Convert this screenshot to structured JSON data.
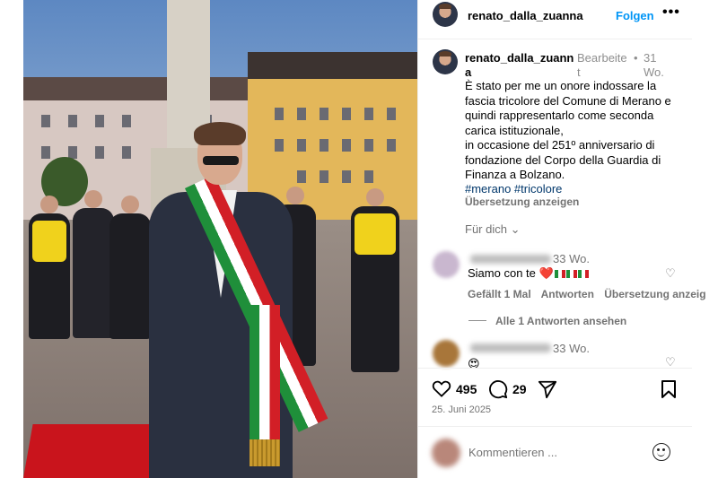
{
  "post": {
    "username": "renato_dalla_zuanna",
    "follow_label": "Folgen",
    "more_label": "•••",
    "photo_alt": "Mann mit Tricolore-Schärpe vor Ehrengarde auf einem Platz"
  },
  "caption": {
    "username_line": "renato_dalla_zuann a",
    "edited": "Bearbeite t",
    "dot": "•",
    "age": "31 Wo.",
    "lines": [
      "È stato per me un onore indossare la fascia tricolore del Comune di Merano e quindi rappresentarlo come seconda carica istituzionale,",
      "in occasione del 251º anniversario di fondazione del Corpo della Guardia di Finanza a Bolzano."
    ],
    "hashtags": "#merano #tricolore",
    "translate_label": "Übersetzung anzeigen",
    "for_you_label": "Für dich ⌄"
  },
  "comments": [
    {
      "age": "33 Wo.",
      "text": "Siamo con te",
      "emoji": "❤️",
      "likes_label": "Gefällt 1 Mal",
      "reply_label": "Antworten",
      "translate_label": "Übersetzung anzeig",
      "view_replies": "Alle 1 Antworten ansehen"
    },
    {
      "age": "33 Wo.",
      "text": "😍"
    }
  ],
  "actions": {
    "like_icon": "heart-icon",
    "like_count": "495",
    "comment_icon": "comment-icon",
    "comment_count": "29",
    "share_icon": "paper-plane-icon",
    "save_icon": "bookmark-icon",
    "date": "25. Juni 2025"
  },
  "composer": {
    "placeholder": "Kommentieren ..."
  },
  "colors": {
    "link_blue": "#0095f6",
    "muted": "#737373",
    "hashtag": "#00376b"
  }
}
